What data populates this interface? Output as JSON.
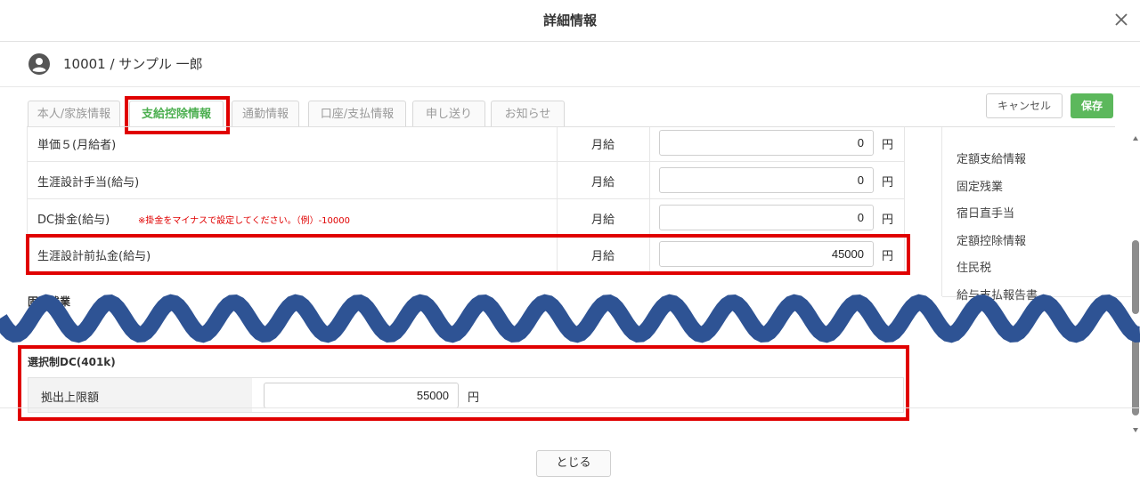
{
  "modal": {
    "title": "詳細情報"
  },
  "user": {
    "label": "10001 / サンプル 一郎"
  },
  "tabs": [
    {
      "label": "本人/家族情報"
    },
    {
      "label": "支給控除情報"
    },
    {
      "label": "通勤情報"
    },
    {
      "label": "口座/支払情報"
    },
    {
      "label": "申し送り"
    },
    {
      "label": "お知らせ"
    }
  ],
  "actions": {
    "cancel": "キャンセル",
    "save": "保存"
  },
  "rows": [
    {
      "label": "単価５(月給者)",
      "type": "月給",
      "value": "0",
      "unit": "円"
    },
    {
      "label": "生涯設計手当(給与)",
      "type": "月給",
      "value": "0",
      "unit": "円"
    },
    {
      "label": "DC掛金(給与)",
      "note": "※掛金をマイナスで設定してください。（例）-10000",
      "type": "月給",
      "value": "0",
      "unit": "円"
    },
    {
      "label": "生涯設計前払金(給与)",
      "type": "月給",
      "value": "45000",
      "unit": "円"
    }
  ],
  "section_partial": "固定残業",
  "dc_section": {
    "title": "選択制DC(401k)",
    "row": {
      "label": "拠出上限額",
      "value": "55000",
      "unit": "円"
    }
  },
  "right_nav": [
    {
      "label": "定額支給情報"
    },
    {
      "label": "固定残業"
    },
    {
      "label": "宿日直手当"
    },
    {
      "label": "定額控除情報"
    },
    {
      "label": "住民税"
    },
    {
      "label": "給与支払報告書"
    }
  ],
  "footer": {
    "close": "とじる"
  },
  "colors": {
    "accent": "#4caf50",
    "save": "#5cb85c",
    "highlight": "#e00000",
    "wave": "#2e5394"
  }
}
